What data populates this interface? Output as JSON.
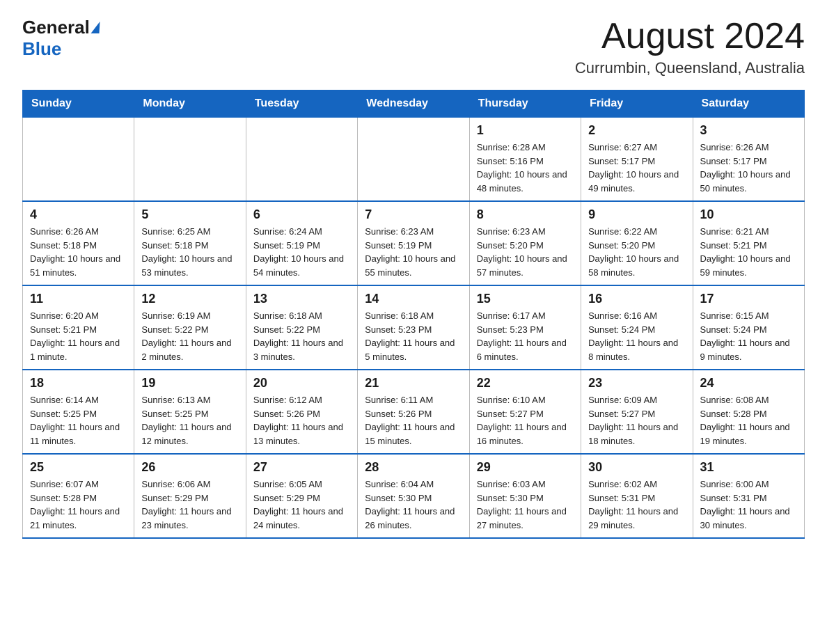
{
  "header": {
    "logo_general": "General",
    "logo_blue": "Blue",
    "month_title": "August 2024",
    "location": "Currumbin, Queensland, Australia"
  },
  "days_of_week": [
    "Sunday",
    "Monday",
    "Tuesday",
    "Wednesday",
    "Thursday",
    "Friday",
    "Saturday"
  ],
  "weeks": [
    {
      "cells": [
        {
          "day": "",
          "info": ""
        },
        {
          "day": "",
          "info": ""
        },
        {
          "day": "",
          "info": ""
        },
        {
          "day": "",
          "info": ""
        },
        {
          "day": "1",
          "info": "Sunrise: 6:28 AM\nSunset: 5:16 PM\nDaylight: 10 hours and 48 minutes."
        },
        {
          "day": "2",
          "info": "Sunrise: 6:27 AM\nSunset: 5:17 PM\nDaylight: 10 hours and 49 minutes."
        },
        {
          "day": "3",
          "info": "Sunrise: 6:26 AM\nSunset: 5:17 PM\nDaylight: 10 hours and 50 minutes."
        }
      ]
    },
    {
      "cells": [
        {
          "day": "4",
          "info": "Sunrise: 6:26 AM\nSunset: 5:18 PM\nDaylight: 10 hours and 51 minutes."
        },
        {
          "day": "5",
          "info": "Sunrise: 6:25 AM\nSunset: 5:18 PM\nDaylight: 10 hours and 53 minutes."
        },
        {
          "day": "6",
          "info": "Sunrise: 6:24 AM\nSunset: 5:19 PM\nDaylight: 10 hours and 54 minutes."
        },
        {
          "day": "7",
          "info": "Sunrise: 6:23 AM\nSunset: 5:19 PM\nDaylight: 10 hours and 55 minutes."
        },
        {
          "day": "8",
          "info": "Sunrise: 6:23 AM\nSunset: 5:20 PM\nDaylight: 10 hours and 57 minutes."
        },
        {
          "day": "9",
          "info": "Sunrise: 6:22 AM\nSunset: 5:20 PM\nDaylight: 10 hours and 58 minutes."
        },
        {
          "day": "10",
          "info": "Sunrise: 6:21 AM\nSunset: 5:21 PM\nDaylight: 10 hours and 59 minutes."
        }
      ]
    },
    {
      "cells": [
        {
          "day": "11",
          "info": "Sunrise: 6:20 AM\nSunset: 5:21 PM\nDaylight: 11 hours and 1 minute."
        },
        {
          "day": "12",
          "info": "Sunrise: 6:19 AM\nSunset: 5:22 PM\nDaylight: 11 hours and 2 minutes."
        },
        {
          "day": "13",
          "info": "Sunrise: 6:18 AM\nSunset: 5:22 PM\nDaylight: 11 hours and 3 minutes."
        },
        {
          "day": "14",
          "info": "Sunrise: 6:18 AM\nSunset: 5:23 PM\nDaylight: 11 hours and 5 minutes."
        },
        {
          "day": "15",
          "info": "Sunrise: 6:17 AM\nSunset: 5:23 PM\nDaylight: 11 hours and 6 minutes."
        },
        {
          "day": "16",
          "info": "Sunrise: 6:16 AM\nSunset: 5:24 PM\nDaylight: 11 hours and 8 minutes."
        },
        {
          "day": "17",
          "info": "Sunrise: 6:15 AM\nSunset: 5:24 PM\nDaylight: 11 hours and 9 minutes."
        }
      ]
    },
    {
      "cells": [
        {
          "day": "18",
          "info": "Sunrise: 6:14 AM\nSunset: 5:25 PM\nDaylight: 11 hours and 11 minutes."
        },
        {
          "day": "19",
          "info": "Sunrise: 6:13 AM\nSunset: 5:25 PM\nDaylight: 11 hours and 12 minutes."
        },
        {
          "day": "20",
          "info": "Sunrise: 6:12 AM\nSunset: 5:26 PM\nDaylight: 11 hours and 13 minutes."
        },
        {
          "day": "21",
          "info": "Sunrise: 6:11 AM\nSunset: 5:26 PM\nDaylight: 11 hours and 15 minutes."
        },
        {
          "day": "22",
          "info": "Sunrise: 6:10 AM\nSunset: 5:27 PM\nDaylight: 11 hours and 16 minutes."
        },
        {
          "day": "23",
          "info": "Sunrise: 6:09 AM\nSunset: 5:27 PM\nDaylight: 11 hours and 18 minutes."
        },
        {
          "day": "24",
          "info": "Sunrise: 6:08 AM\nSunset: 5:28 PM\nDaylight: 11 hours and 19 minutes."
        }
      ]
    },
    {
      "cells": [
        {
          "day": "25",
          "info": "Sunrise: 6:07 AM\nSunset: 5:28 PM\nDaylight: 11 hours and 21 minutes."
        },
        {
          "day": "26",
          "info": "Sunrise: 6:06 AM\nSunset: 5:29 PM\nDaylight: 11 hours and 23 minutes."
        },
        {
          "day": "27",
          "info": "Sunrise: 6:05 AM\nSunset: 5:29 PM\nDaylight: 11 hours and 24 minutes."
        },
        {
          "day": "28",
          "info": "Sunrise: 6:04 AM\nSunset: 5:30 PM\nDaylight: 11 hours and 26 minutes."
        },
        {
          "day": "29",
          "info": "Sunrise: 6:03 AM\nSunset: 5:30 PM\nDaylight: 11 hours and 27 minutes."
        },
        {
          "day": "30",
          "info": "Sunrise: 6:02 AM\nSunset: 5:31 PM\nDaylight: 11 hours and 29 minutes."
        },
        {
          "day": "31",
          "info": "Sunrise: 6:00 AM\nSunset: 5:31 PM\nDaylight: 11 hours and 30 minutes."
        }
      ]
    }
  ]
}
